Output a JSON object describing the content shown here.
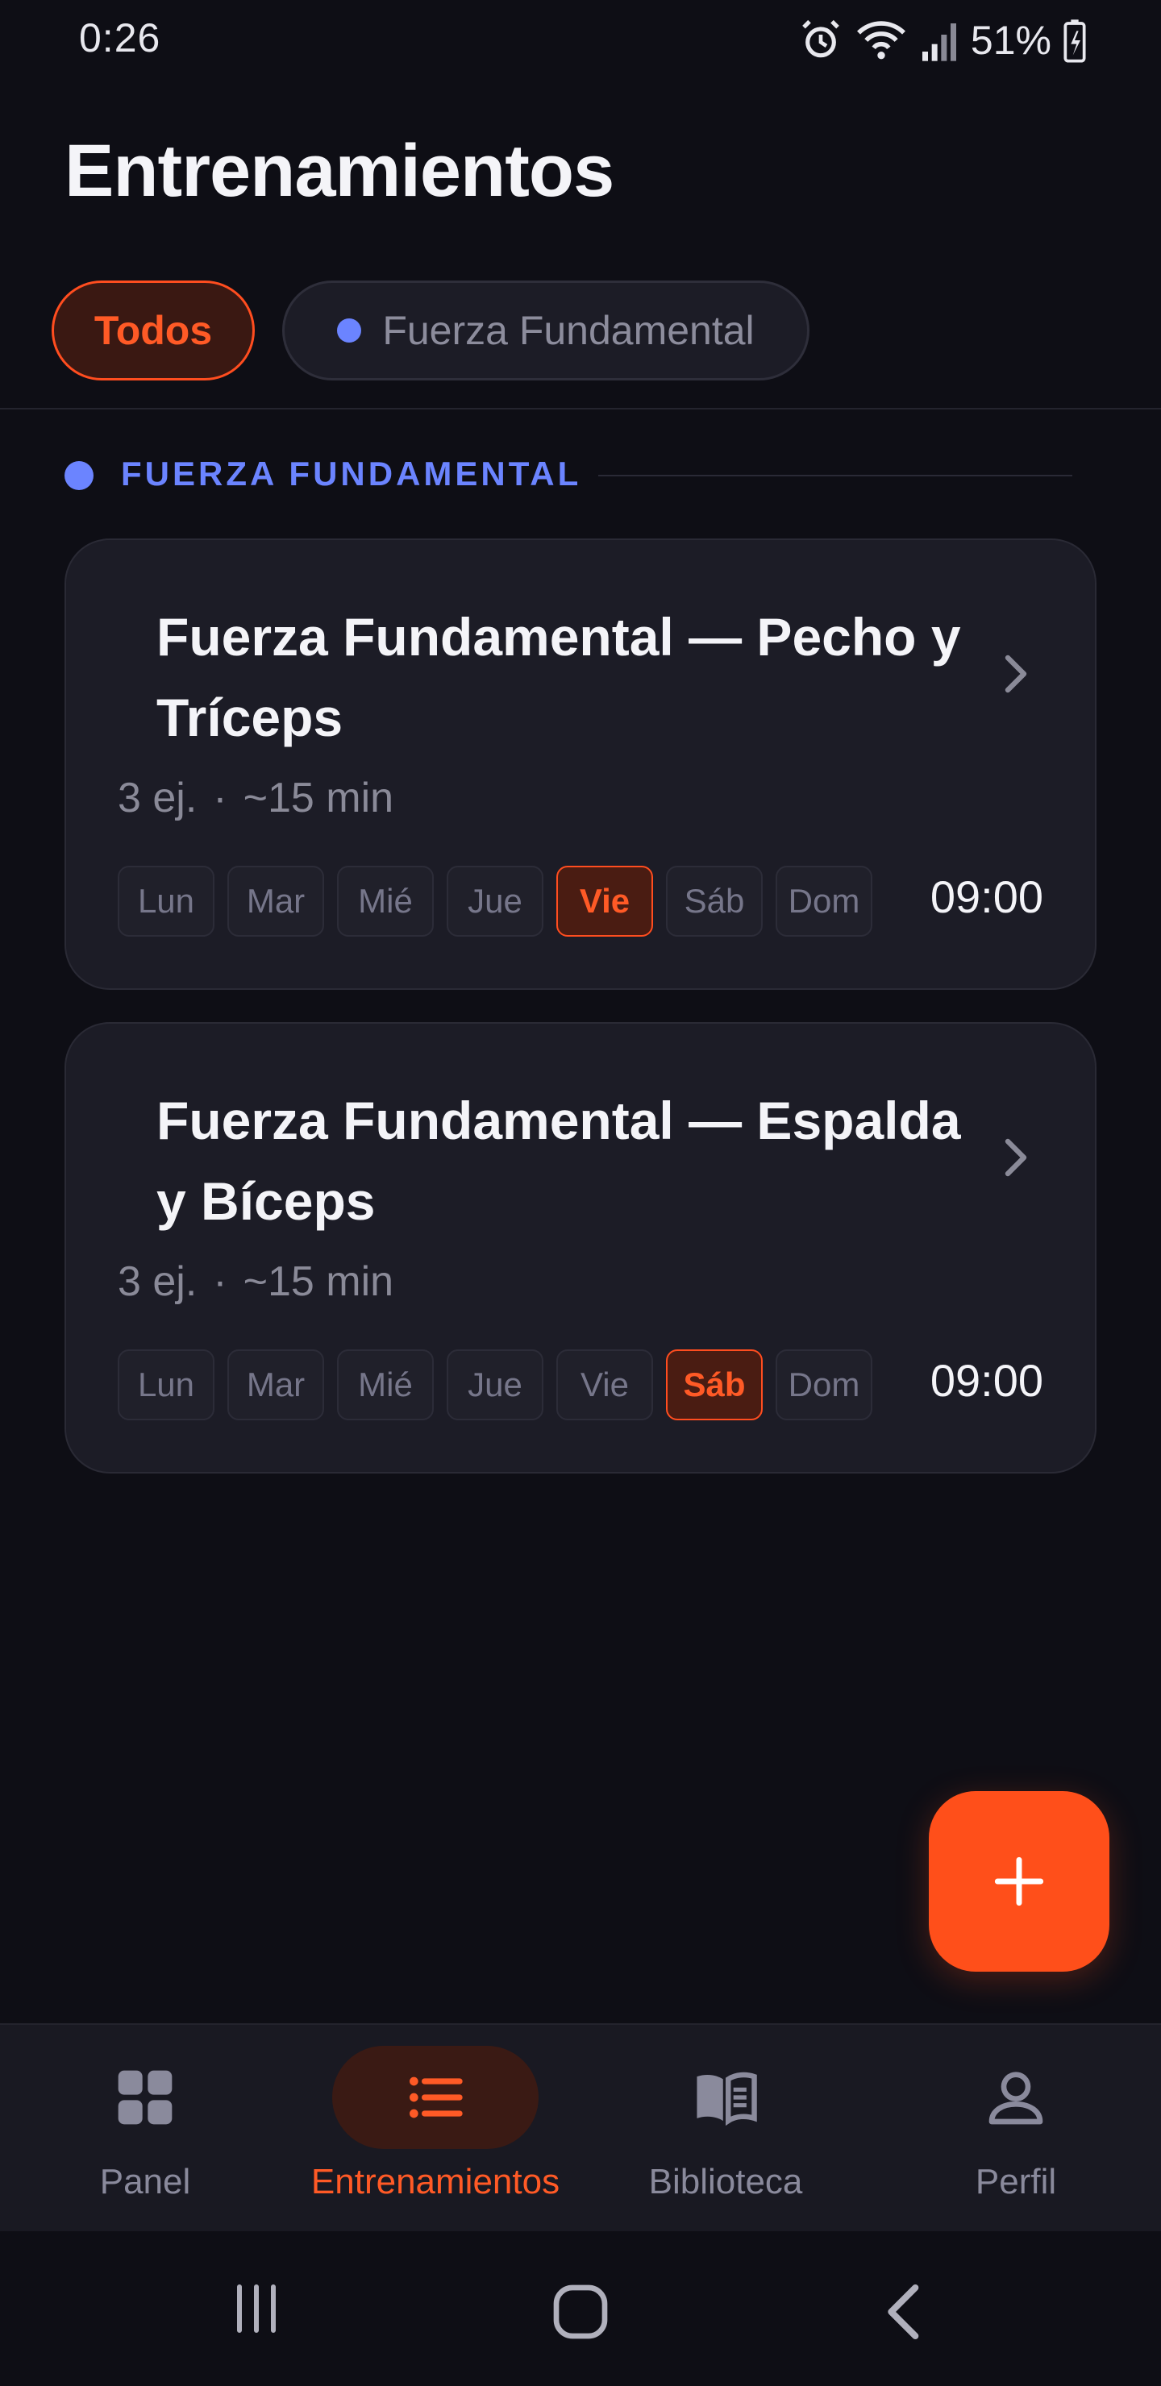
{
  "status_bar": {
    "time": "0:26",
    "battery": "51%"
  },
  "page_title": "Entrenamientos",
  "filters": {
    "all": "Todos",
    "category": "Fuerza Fundamental"
  },
  "section": {
    "label": "FUERZA FUNDAMENTAL",
    "color": "#6b84ff"
  },
  "workouts": [
    {
      "title": "Fuerza Fundamental — Pecho y Tríceps",
      "exercises": "3 ej.",
      "separator": "·",
      "duration": "~15 min",
      "days": [
        "Lun",
        "Mar",
        "Mié",
        "Jue",
        "Vie",
        "Sáb",
        "Dom"
      ],
      "active_day": "Vie",
      "time": "09:00"
    },
    {
      "title": "Fuerza Fundamental — Espalda y Bíceps",
      "exercises": "3 ej.",
      "separator": "·",
      "duration": "~15 min",
      "days": [
        "Lun",
        "Mar",
        "Mié",
        "Jue",
        "Vie",
        "Sáb",
        "Dom"
      ],
      "active_day": "Sáb",
      "time": "09:00"
    }
  ],
  "fab_icon": "plus-icon",
  "nav": {
    "items": [
      {
        "label": "Panel",
        "icon": "grid-icon"
      },
      {
        "label": "Entrenamientos",
        "icon": "list-icon"
      },
      {
        "label": "Biblioteca",
        "icon": "book-icon"
      },
      {
        "label": "Perfil",
        "icon": "person-icon"
      }
    ],
    "active": "Entrenamientos"
  },
  "colors": {
    "accent": "#ff4f1a",
    "background": "#0e0e15",
    "card": "#1c1c26",
    "category": "#6b84ff"
  }
}
